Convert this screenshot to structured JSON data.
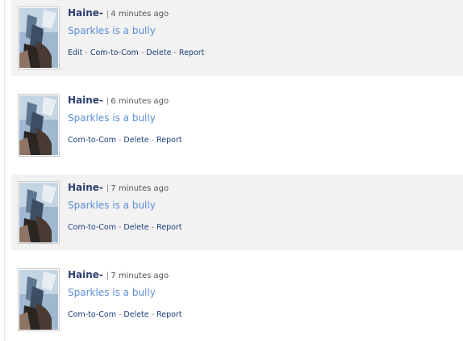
{
  "separator": "|",
  "action_separator": "-",
  "comments": [
    {
      "username": "Haine-",
      "time": "4 minutes ago",
      "text": "Sparkles is a bully",
      "actions": [
        "Edit",
        "Com-to-Com",
        "Delete",
        "Report"
      ]
    },
    {
      "username": "Haine-",
      "time": "6 minutes ago",
      "text": "Sparkles is a bully",
      "actions": [
        "Com-to-Com",
        "Delete",
        "Report"
      ]
    },
    {
      "username": "Haine-",
      "time": "7 minutes ago",
      "text": "Sparkles is a bully",
      "actions": [
        "Com-to-Com",
        "Delete",
        "Report"
      ]
    },
    {
      "username": "Haine-",
      "time": "7 minutes ago",
      "text": "Sparkles is a bully",
      "actions": [
        "Com-to-Com",
        "Delete",
        "Report"
      ]
    }
  ],
  "colors": {
    "username": "#2b3f6e",
    "comment_text": "#5b8ed6",
    "action_link": "#1f3d7a",
    "shaded_row": "#f2f2f2"
  }
}
